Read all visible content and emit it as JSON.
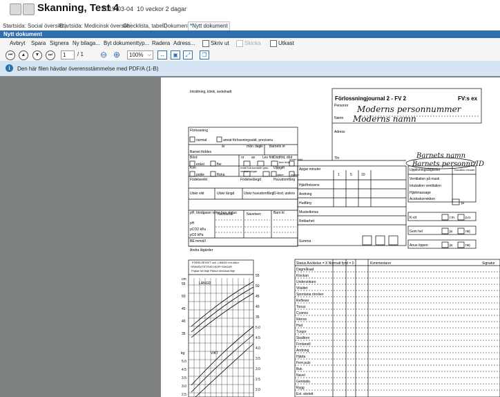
{
  "header": {
    "title": "Skanning, Test 4",
    "date": "2019-03-04",
    "age": "10 veckor 2 dagar"
  },
  "tabs": [
    {
      "label": "Startsida: Social översikt"
    },
    {
      "label": "Startsida: Medicinsk översikt"
    },
    {
      "label": "Checklista, tabell"
    },
    {
      "label": "Dokument"
    },
    {
      "label": "*Nytt dokument"
    }
  ],
  "panel": {
    "title": "Nytt dokument"
  },
  "toolbar": {
    "avbryt": "Avbryt",
    "spara": "Spara",
    "signera": "Signera",
    "ny_bilaga": "Ny bilaga...",
    "byt_dokumenttyp": "Byt dokumenttyp...",
    "radera": "Radera",
    "adress": "Adress...",
    "skriv_ut": "Skriv ut",
    "skicka": "Skicka",
    "utkast": "Utkast"
  },
  "navigation": {
    "page_current": "1",
    "page_total": "/ 1",
    "zoom": "100%"
  },
  "info_bar": {
    "message": "Den här filen hävdar överensstämmelse med PDF/A (1-B)"
  },
  "document": {
    "top_left": "Inträttning, klinik, avdelnadt",
    "title": "Förlossningjournal 2 - FV 2",
    "code": "FV:s ex",
    "personnr_label": "Personnr",
    "personnr_hand": "Moderns personnummer",
    "namn_label": "Namn",
    "namn_hand": "Moderns namn",
    "adress_label": "Adress",
    "tfn_label": "Tfn",
    "barn_namn_hand": "Barnets namn",
    "barn_pnr_hand": "Barnets personnr/ID",
    "left_rows": {
      "forlossning": "Förlossning",
      "normal": "normal",
      "annat_satt": "annat förlossningssätt, precisera",
      "ar": "år",
      "man": "mån",
      "dag": "dag",
      "kl": "kl",
      "barnets_nr": "Barnets nr",
      "barnet_fodde": "Barnet föddes",
      "bord": "Börd",
      "enkel": "enkel",
      "fler": "fler",
      "nr": "nr",
      "av": "av",
      "lev_fott": "Lev fött",
      "dodfott": "Dödfött, död",
      "fore_fodd": "före född",
      "under": "under född",
      "kon": "Kön",
      "pojke": "pojke",
      "flicka": "flicka",
      "antal_fullb": "Antal full-bordade grav.",
      "veckor_dagar": "veckor+dagar",
      "uppgift": "Uppgift",
      "saker": "säker",
      "osaker": "osäker",
      "fodelsevikt": "Födelsevikt",
      "fodelselangd": "Födelselängd",
      "huvudomfang": "Huvudomfång",
      "utskr_vikt": "Utskr vikt",
      "utskr_langd": "Utskr längd",
      "utskr_huvud": "Utskr huvudomfång",
      "id_kod": "ID-kod, utskriv",
      "ph_blod": "pH, blodgaser sytra-bas status",
      "navelartar": "Navelartär",
      "navelven": "Navelven",
      "barn_kl": "Barn kl",
      "ph": "pH",
      "pco2": "pCO2 kPa",
      "po2": "pO2 kPa",
      "be": "BE mmol/l",
      "andra_atgarder": "Andra åtgärder"
    },
    "mid_rows": {
      "apgar": "Apgar minuter",
      "apgar_1": "1",
      "apgar_5": "5",
      "apgar_10": "10",
      "hjartfrekvens": "Hjärtfrekvens",
      "andning": "Andning",
      "hudfarg": "Hudfärg",
      "muskeltonus": "Muskeltonus",
      "retbarhet": "Retbarhet",
      "summa": "Summa"
    },
    "right_rows": {
      "upplivning": "Upplivningsåtgärder",
      "duration": "Duration minuter",
      "ventilation_mask": "Ventilation på mask",
      "intubation": "Intubation ventilation",
      "hjartmassage": "Hjärtmassage",
      "acidos": "Acidoskorrektion",
      "ja": "ja",
      "k_vit": "K-vit",
      "im": "i.m.",
      "po": "p.o.",
      "gom_hel": "Gom hel",
      "nej": "nej",
      "anus": "Anus öppen"
    },
    "status": {
      "header": "Status Avvikelse = X Normalt fynd = 0",
      "kommentarer": "Kommentarer",
      "signatur": "Signatur",
      "items": [
        "Dagmålsad",
        "Klockan",
        "Undersökare",
        "Vitalitet",
        "Spontana rörelser",
        "Reflexer",
        "Tonus",
        "Cyanos",
        "Ikterus",
        "Hud",
        "Turgor",
        "Skalltorn",
        "Fontanell",
        "Andning",
        "Hjärta",
        "Fem.puls",
        "Buk",
        "Navel",
        "Genitalia",
        "Rygg",
        "Ext. skelett",
        "Höfter"
      ]
    },
    "chart": {
      "header1": "FÖDELSEVIKT och -LÄNGD enl.störa",
      "header2": "GRAVIDITETSVECKOR+DAGAR",
      "header3": "Pojkar hel linje Flickor streckad linje",
      "cm": "cm",
      "langd": "LÄNGD",
      "vikt": "VIKT",
      "kg": "kg",
      "left_ticks": [
        "55",
        "50",
        "45",
        "40",
        "35",
        "5.0",
        "4.5",
        "3.5",
        "3.0",
        "2.5"
      ],
      "right_ticks": [
        "55",
        "50",
        "45",
        "40",
        "35",
        "5.0",
        "4.5",
        "4.0",
        "3.5",
        "3.0",
        "2.5",
        "2.0"
      ]
    }
  }
}
